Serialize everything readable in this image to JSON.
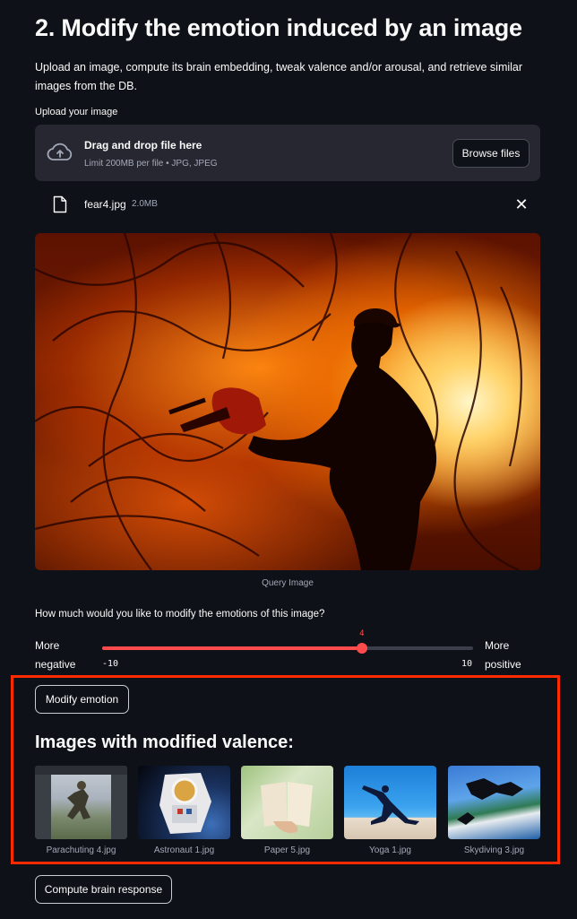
{
  "header": {
    "title": "2. Modify the emotion induced by an image",
    "description": "Upload an image, compute its brain embedding, tweak valence and/or arousal, and retrieve similar images from the DB."
  },
  "uploader": {
    "label": "Upload your image",
    "drop_title": "Drag and drop file here",
    "drop_subtitle": "Limit 200MB per file • JPG, JPEG",
    "browse_label": "Browse files",
    "close_glyph": "✕",
    "file": {
      "name": "fear4.jpg",
      "size": "2.0MB"
    }
  },
  "query_image": {
    "caption": "Query Image"
  },
  "slider": {
    "question": "How much would you like to modify the emotions of this image?",
    "left_label_1": "More",
    "left_label_2": "negative",
    "right_label_1": "More",
    "right_label_2": "positive",
    "min": -10,
    "max": 10,
    "value": 4,
    "min_label": "-10",
    "max_label": "10",
    "value_label": "4",
    "accent_color": "#ff4b4b"
  },
  "modify_button": {
    "label": "Modify emotion"
  },
  "results": {
    "title": "Images with modified valence:",
    "images": [
      {
        "caption": "Parachuting 4.jpg"
      },
      {
        "caption": "Astronaut 1.jpg"
      },
      {
        "caption": "Paper 5.jpg"
      },
      {
        "caption": "Yoga 1.jpg"
      },
      {
        "caption": "Skydiving 3.jpg"
      }
    ]
  },
  "compute_button": {
    "label": "Compute brain response"
  },
  "colors": {
    "background": "#0e1117",
    "panel": "#262730",
    "highlight_border": "#ff2a00"
  }
}
